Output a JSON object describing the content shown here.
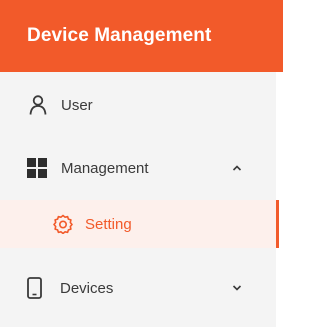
{
  "header": {
    "title": "Device Management"
  },
  "menu": {
    "items": [
      {
        "label": "User",
        "icon": "user-icon"
      },
      {
        "label": "Management",
        "icon": "grid-icon",
        "expanded": true
      },
      {
        "label": "Setting",
        "icon": "gear-icon",
        "active": true
      },
      {
        "label": "Devices",
        "icon": "mobile-icon",
        "expanded": false
      }
    ]
  },
  "colors": {
    "accent": "#f25a2a",
    "sidebar_bg": "#f4f4f4",
    "active_bg": "#fdf0ec",
    "text": "#3a3a3a"
  }
}
